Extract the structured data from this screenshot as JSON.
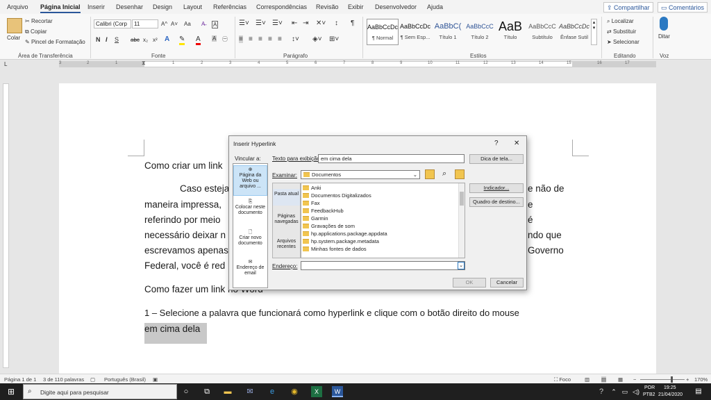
{
  "tabs": [
    "Arquivo",
    "Página Inicial",
    "Inserir",
    "Desenhar",
    "Design",
    "Layout",
    "Referências",
    "Correspondências",
    "Revisão",
    "Exibir",
    "Desenvolvedor",
    "Ajuda"
  ],
  "share": "Compartilhar",
  "comments": "Comentários",
  "clipboard": {
    "paste": "Colar",
    "cut": "Recortar",
    "copy": "Copiar",
    "format_painter": "Pincel de Formatação",
    "label": "Área de Transferência"
  },
  "font": {
    "name": "Calibri (Corp",
    "size": "11",
    "label": "Fonte",
    "grow": "A^",
    "shrink": "A˅",
    "case": "Aa",
    "bold": "N",
    "italic": "I",
    "underline": "S",
    "strike": "abc",
    "sub": "x₂",
    "sup": "x²"
  },
  "paragraph": {
    "label": "Parágrafo"
  },
  "styles": {
    "label": "Estilos",
    "items": [
      {
        "preview": "AaBbCcDc",
        "name": "¶ Normal"
      },
      {
        "preview": "AaBbCcDc",
        "name": "¶ Sem Esp..."
      },
      {
        "preview": "AaBbC(",
        "name": "Título 1"
      },
      {
        "preview": "AaBbCcC",
        "name": "Título 2"
      },
      {
        "preview": "AaB",
        "name": "Título"
      },
      {
        "preview": "AaBbCcC",
        "name": "Subtítulo"
      },
      {
        "preview": "AaBbCcDc",
        "name": "Ênfase Sutil"
      }
    ]
  },
  "editing": {
    "label": "Editando",
    "find": "Localizar",
    "replace": "Substituir",
    "select": "Selecionar"
  },
  "voice": {
    "label": "Voz",
    "dictate": "Ditar"
  },
  "ruler_numbers": [
    "3",
    "2",
    "1",
    "1",
    "2",
    "3",
    "4",
    "5",
    "6",
    "7",
    "8",
    "9",
    "10",
    "11",
    "12",
    "13",
    "14",
    "15",
    "16",
    "17"
  ],
  "document": {
    "line1": "Como criar um link",
    "line2a": "Caso esteja",
    "line2b": "e não de",
    "line3a": "maneira impressa,",
    "line3b": "e",
    "line4a": "referindo por meio",
    "line4b": "é",
    "line5a": "necessário deixar n",
    "line5b": "ndo que",
    "line6a": "escrevamos apenas",
    "line6b": "Governo",
    "line7a": "Federal, você é red",
    "line8": "Como fazer um link no Word",
    "line9": "1 – Selecione a palavra que funcionará como hyperlink e clique com o botão direito do mouse",
    "line10": "em cima dela"
  },
  "dialog": {
    "title": "Inserir Hyperlink",
    "help": "?",
    "close": "✕",
    "link_to": "Vincular a:",
    "display_label": "Texto para exibição:",
    "display_value": "em cima dela",
    "screentip": "Dica de tela...",
    "look_in": "Examinar:",
    "look_value": "Documentos",
    "link_items": [
      "Página da Web ou arquivo ...",
      "Colocar neste documento",
      "Criar novo documento",
      "Endereço de email"
    ],
    "places": [
      "Pasta atual",
      "Páginas navegadas",
      "Arquivos recentes"
    ],
    "files": [
      "Anki",
      "Documentos Digitalizados",
      "Fax",
      "FeedbackHub",
      "Garmin",
      "Gravações de som",
      "hp.applications.package.appdata",
      "hp.system.package.metadata",
      "Minhas fontes de dados"
    ],
    "bookmark": "Indicador...",
    "target_frame": "Quadro de destino...",
    "address_label": "Endereço:",
    "address_value": "",
    "ok": "OK",
    "cancel": "Cancelar"
  },
  "status": {
    "page": "Página 1 de 1",
    "words": "3 de 110 palavras",
    "language": "Português (Brasil)",
    "focus": "Foco",
    "zoom": "170%"
  },
  "taskbar": {
    "search_placeholder": "Digite aqui para pesquisar",
    "lang": "POR",
    "lang2": "PTB2",
    "time": "19:25",
    "date": "21/04/2020"
  }
}
